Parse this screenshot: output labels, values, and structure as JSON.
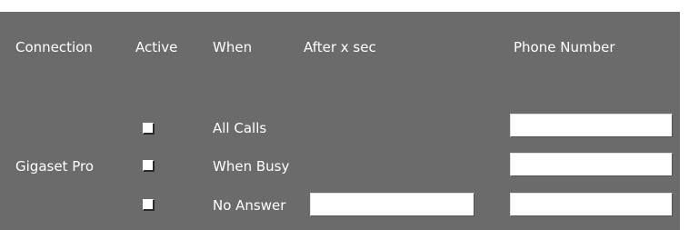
{
  "headers": {
    "connection": "Connection",
    "active": "Active",
    "when": "When",
    "after_x_sec": "After x sec",
    "phone_number": "Phone Number"
  },
  "connection_name": "Gigaset Pro",
  "rows": [
    {
      "when": "All Calls",
      "active": false,
      "after_x_sec": null,
      "phone_number": ""
    },
    {
      "when": "When Busy",
      "active": false,
      "after_x_sec": null,
      "phone_number": ""
    },
    {
      "when": "No Answer",
      "active": false,
      "after_x_sec": "",
      "phone_number": ""
    }
  ],
  "colors": {
    "panel_background": "#6b6b6b",
    "text": "#ffffff",
    "input_background": "#ffffff"
  }
}
